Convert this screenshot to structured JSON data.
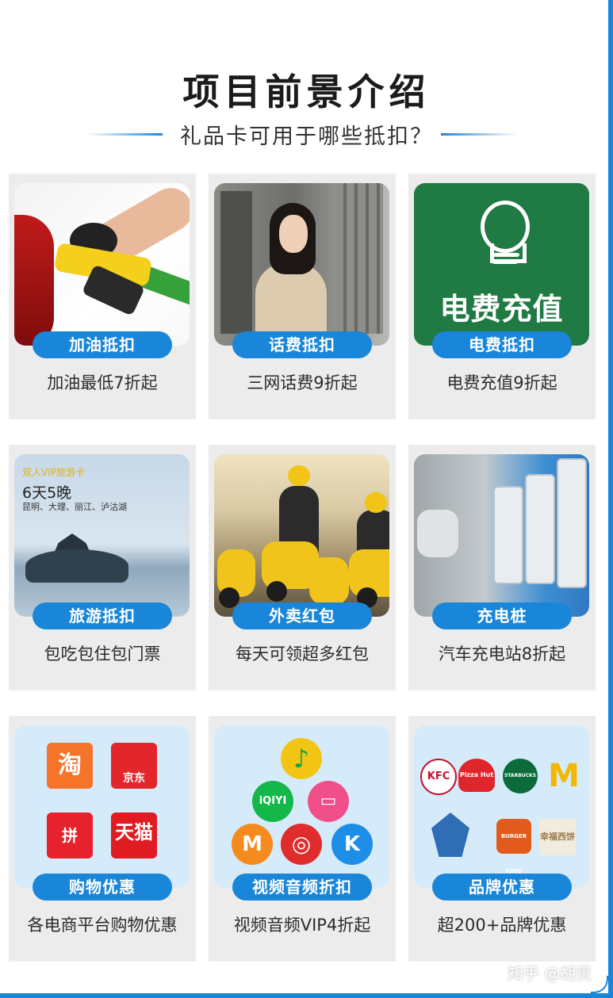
{
  "header": {
    "title": "项目前景介绍",
    "subtitle": "礼品卡可用于哪些抵扣？"
  },
  "colors": {
    "accent": "#1a86d9",
    "card_bg": "#ececec",
    "logo_panel_bg": "#d6ebfa"
  },
  "cards": [
    {
      "pill": "加油抵扣",
      "caption": "加油最低7折起",
      "icon": "fuel-nozzle-photo"
    },
    {
      "pill": "话费抵扣",
      "caption": "三网话费9折起",
      "icon": "woman-on-phone-photo"
    },
    {
      "pill": "电费抵扣",
      "caption": "电费充值9折起",
      "icon": "lightbulb-icon",
      "image_text": "电费充值"
    },
    {
      "pill": "旅游抵扣",
      "caption": "包吃包住包门票",
      "icon": "travel-island-photo",
      "image_tag": "双人VIP旅游卡",
      "image_days": "6天5晚",
      "image_places": "昆明、大理、丽江、泸沽湖"
    },
    {
      "pill": "外卖红包",
      "caption": "每天可领超多红包",
      "icon": "delivery-riders-photo"
    },
    {
      "pill": "充电桩",
      "caption": "汽车充电站8折起",
      "icon": "ev-charging-photo"
    },
    {
      "pill": "购物优惠",
      "caption": "各电商平台购物优惠",
      "icon": "shopping-logos",
      "logos": [
        "淘",
        "京东",
        "拼",
        "天猫"
      ]
    },
    {
      "pill": "视频音频折扣",
      "caption": "视频音频VIP4折起",
      "icon": "video-audio-logos",
      "logos": [
        "♪",
        "iQIYI",
        "▭",
        "M",
        "◎",
        "K"
      ]
    },
    {
      "pill": "品牌优惠",
      "caption": "超200+品牌优惠",
      "icon": "brand-logos",
      "logos": [
        "KFC",
        "Pizza Hut",
        "STARBUCKS",
        "M",
        "BURGER KING",
        "幸福西饼"
      ]
    }
  ],
  "watermark": "知乎 @胡贵"
}
